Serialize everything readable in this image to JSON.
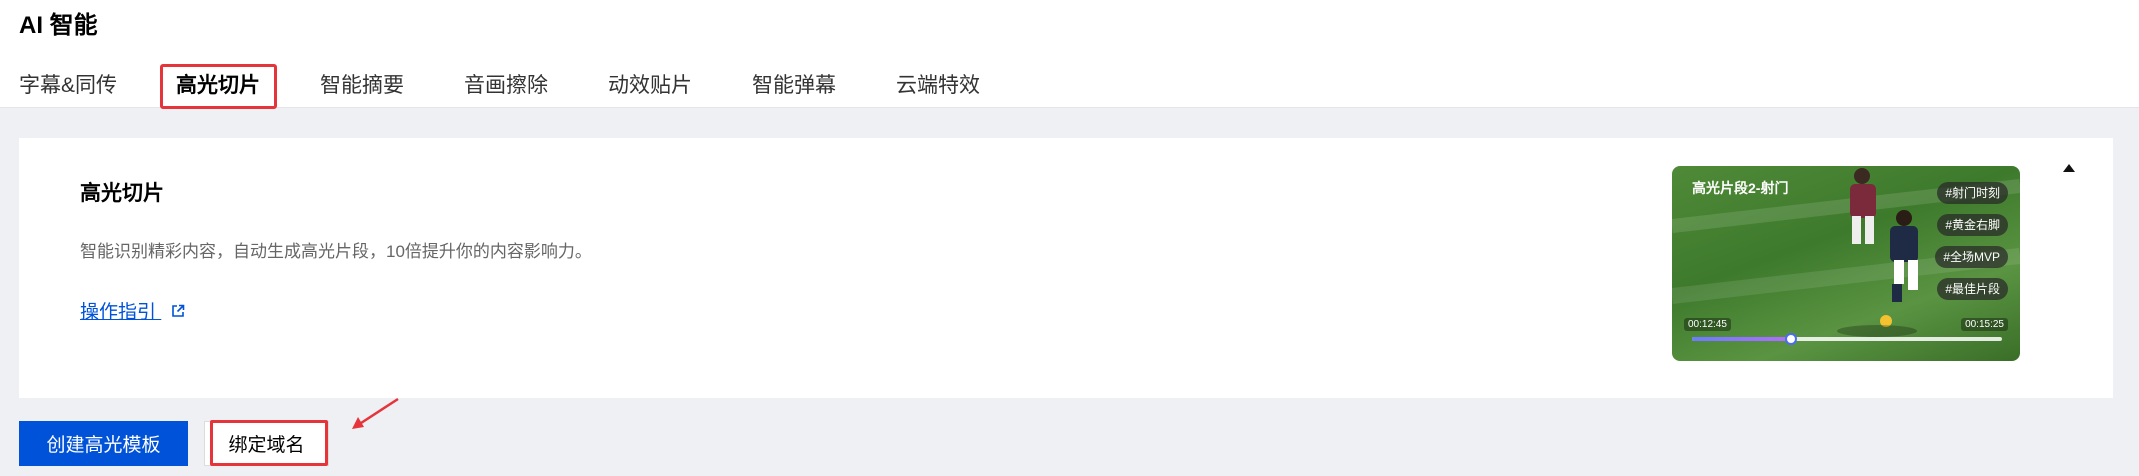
{
  "app": {
    "title": "AI 智能"
  },
  "tabs": [
    {
      "label": "字幕&同传"
    },
    {
      "label": "高光切片"
    },
    {
      "label": "智能摘要"
    },
    {
      "label": "音画擦除"
    },
    {
      "label": "动效贴片"
    },
    {
      "label": "智能弹幕"
    },
    {
      "label": "云端特效"
    }
  ],
  "active_tab": "高光切片",
  "card": {
    "title": "高光切片",
    "description": "智能识别精彩内容，自动生成高光片段，10倍提升你的内容影响力。",
    "guide_link": "操作指引",
    "collapse_icon": "triangle-up-icon",
    "preview": {
      "title": "高光片段2-射门",
      "tags": [
        "#射门时刻",
        "#黄金右脚",
        "#全场MVP",
        "#最佳片段"
      ],
      "time_start": "00:12:45",
      "time_end": "00:15:25",
      "progress": 0.32
    }
  },
  "actions": {
    "create_label": "创建高光模板",
    "bind_label": "绑定域名"
  },
  "colors": {
    "primary": "#0052d9",
    "highlight": "#e5343a",
    "background": "#eef0f4"
  }
}
